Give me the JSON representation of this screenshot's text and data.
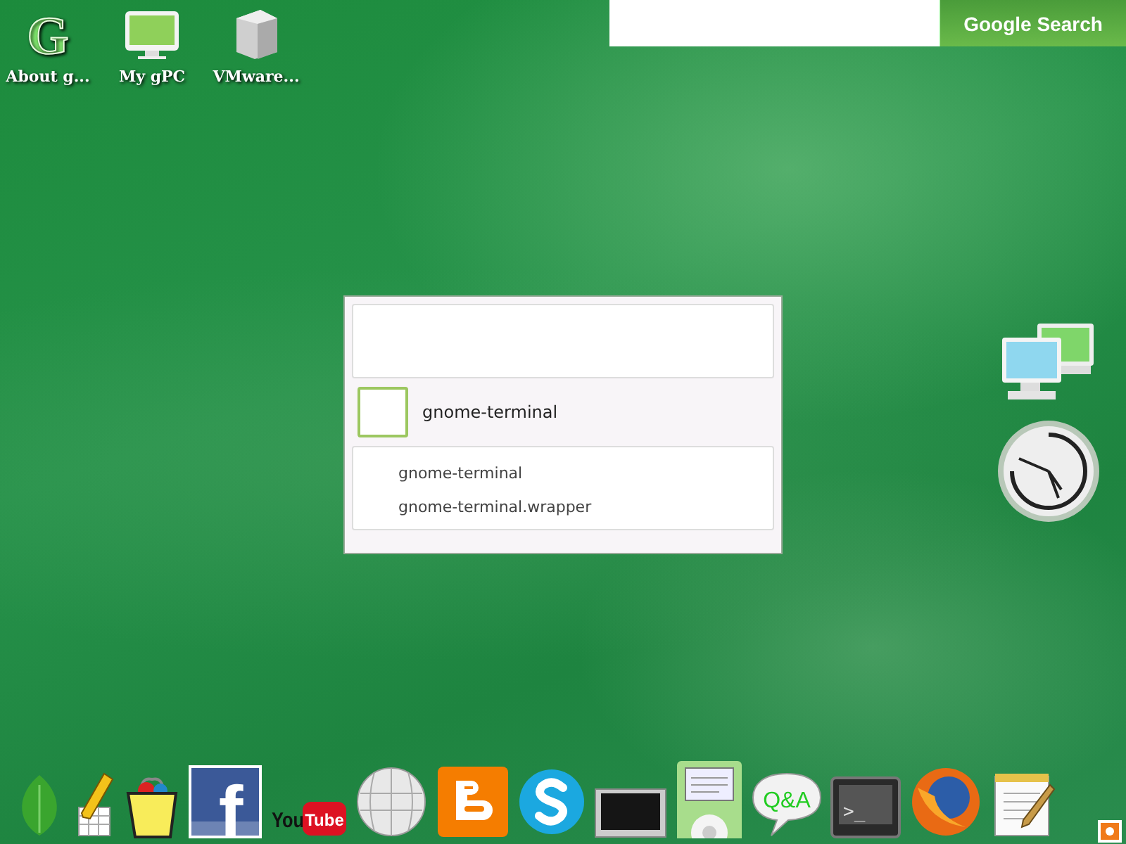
{
  "desktop_icons": [
    {
      "kind": "letter",
      "label": "About g...",
      "glyph": "G"
    },
    {
      "kind": "computer",
      "label": "My gPC"
    },
    {
      "kind": "box",
      "label": "VMware..."
    }
  ],
  "search": {
    "button": "Google Search"
  },
  "launcher": {
    "result": "gnome-terminal",
    "matches": [
      "gnome-terminal",
      "gnome-terminal.wrapper"
    ]
  },
  "widgets": [
    {
      "kind": "network"
    },
    {
      "kind": "clock"
    }
  ],
  "dock": [
    {
      "kind": "leaf"
    },
    {
      "kind": "pencil"
    },
    {
      "kind": "bag"
    },
    {
      "kind": "ftile",
      "glyphs": [
        "f"
      ]
    },
    {
      "kind": "video",
      "glyphs": [
        "You",
        "Tube"
      ]
    },
    {
      "kind": "globe"
    },
    {
      "kind": "orange"
    },
    {
      "kind": "stile"
    },
    {
      "kind": "monitor"
    },
    {
      "kind": "player"
    },
    {
      "kind": "bubble",
      "glyphs": [
        "Q&A"
      ]
    },
    {
      "kind": "terminal",
      "glyphs": [
        ">_"
      ]
    },
    {
      "kind": "fox"
    },
    {
      "kind": "notepad"
    }
  ],
  "tray": [
    {
      "kind": "star"
    }
  ]
}
